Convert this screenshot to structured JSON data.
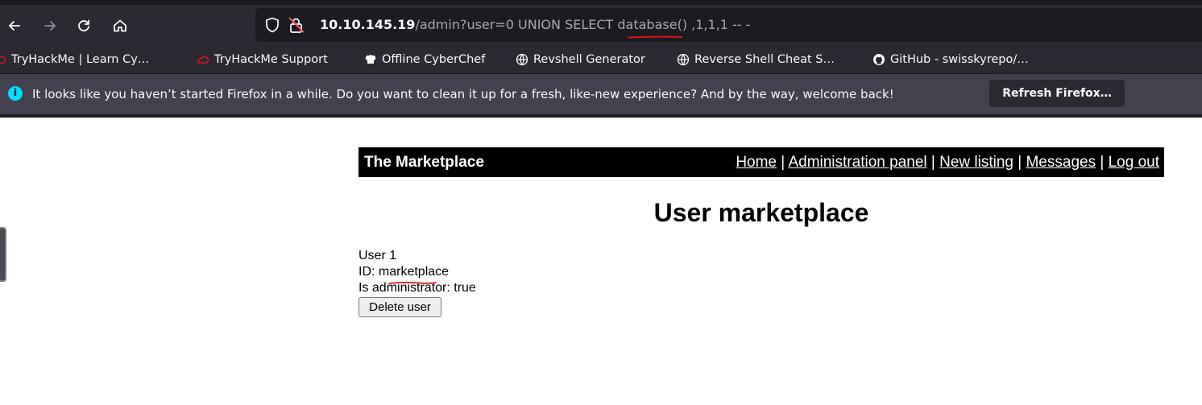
{
  "browser": {
    "nav": {
      "back_icon": "arrow-left-icon",
      "forward_icon": "arrow-right-icon",
      "reload_icon": "reload-icon",
      "home_icon": "home-icon"
    },
    "url": {
      "host": "10.10.145.19",
      "rest": "/admin?user=0 UNION SELECT database() ,1,1,1 -- -"
    },
    "bookmarks": [
      {
        "label": "TryHackMe | Learn Cy…",
        "icon": "tryhackme-icon"
      },
      {
        "label": "TryHackMe Support",
        "icon": "tryhackme-icon"
      },
      {
        "label": "Offline CyberChef",
        "icon": "chef-hat-icon"
      },
      {
        "label": "Revshell Generator",
        "icon": "globe-icon"
      },
      {
        "label": "Reverse Shell Cheat S…",
        "icon": "globe-icon"
      },
      {
        "label": "GitHub - swisskyrepo/…",
        "icon": "github-icon"
      }
    ],
    "notification": {
      "message": "It looks like you haven’t started Firefox in a while. Do you want to clean it up for a fresh, like-new experience? And by the way, welcome back!",
      "button": "Refresh Firefox…"
    },
    "colors": {
      "chrome": "#2b2a33",
      "urlbar": "#1c1b22",
      "notice": "#42414d",
      "annotation": "#e0141e"
    }
  },
  "site": {
    "title": "The Marketplace",
    "nav": [
      "Home",
      "Administration panel",
      "New listing",
      "Messages",
      "Log out"
    ],
    "separator": "|"
  },
  "page": {
    "heading": "User marketplace",
    "user": {
      "name_line": "User 1",
      "id_line": "ID: marketplace",
      "admin_line": "Is administrator: true"
    },
    "delete_button": "Delete user"
  }
}
